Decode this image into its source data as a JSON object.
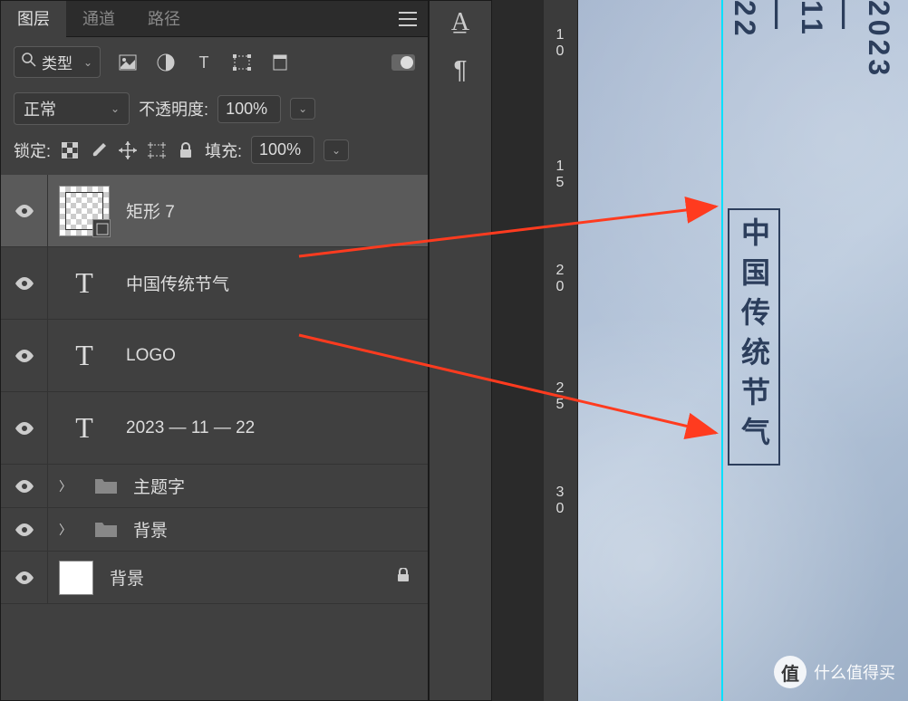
{
  "tabs": {
    "layers": "图层",
    "channels": "通道",
    "paths": "路径"
  },
  "filter": {
    "type_label": "类型",
    "search_icon": "search"
  },
  "blend": {
    "mode": "正常",
    "opacity_label": "不透明度:",
    "opacity_value": "100%"
  },
  "lock": {
    "label": "锁定:",
    "fill_label": "填充:",
    "fill_value": "100%"
  },
  "layers": [
    {
      "name": "矩形 7",
      "type": "shape",
      "selected": true
    },
    {
      "name": "中国传统节气",
      "type": "text"
    },
    {
      "name": "LOGO",
      "type": "text"
    },
    {
      "name": "2023 — 11 — 22",
      "type": "text"
    },
    {
      "name": "主题字",
      "type": "group"
    },
    {
      "name": "背景",
      "type": "group"
    },
    {
      "name": "背景",
      "type": "bg",
      "locked": true
    }
  ],
  "ruler": {
    "marks": [
      "1\n0",
      "1\n5",
      "2\n0",
      "2\n5",
      "3\n0"
    ]
  },
  "canvas": {
    "date_year": "2023",
    "date_month": "11",
    "date_day": "22",
    "boxed": "中国传统节气"
  },
  "watermark": {
    "circle": "值",
    "text": "什么值得买"
  }
}
